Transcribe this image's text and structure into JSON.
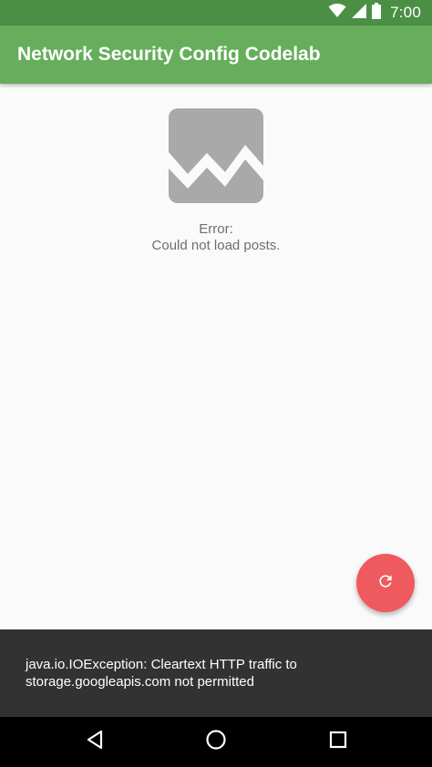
{
  "status_bar": {
    "time": "7:00",
    "icons": [
      "wifi-icon",
      "cellular-signal-icon",
      "battery-icon"
    ]
  },
  "app_bar": {
    "title": "Network Security Config Codelab",
    "color": "#66ae5c"
  },
  "content": {
    "image_icon": "broken-image-icon",
    "error_line1": "Error:",
    "error_line2": "Could not load posts."
  },
  "fab": {
    "icon": "refresh-icon",
    "color": "#ef5a5f"
  },
  "snackbar": {
    "message_line1": "java.io.IOException: Cleartext HTTP traffic to",
    "message_line2": "storage.googleapis.com not permitted"
  },
  "navigation_bar": {
    "buttons": [
      "back-icon",
      "home-icon",
      "recents-icon"
    ]
  }
}
